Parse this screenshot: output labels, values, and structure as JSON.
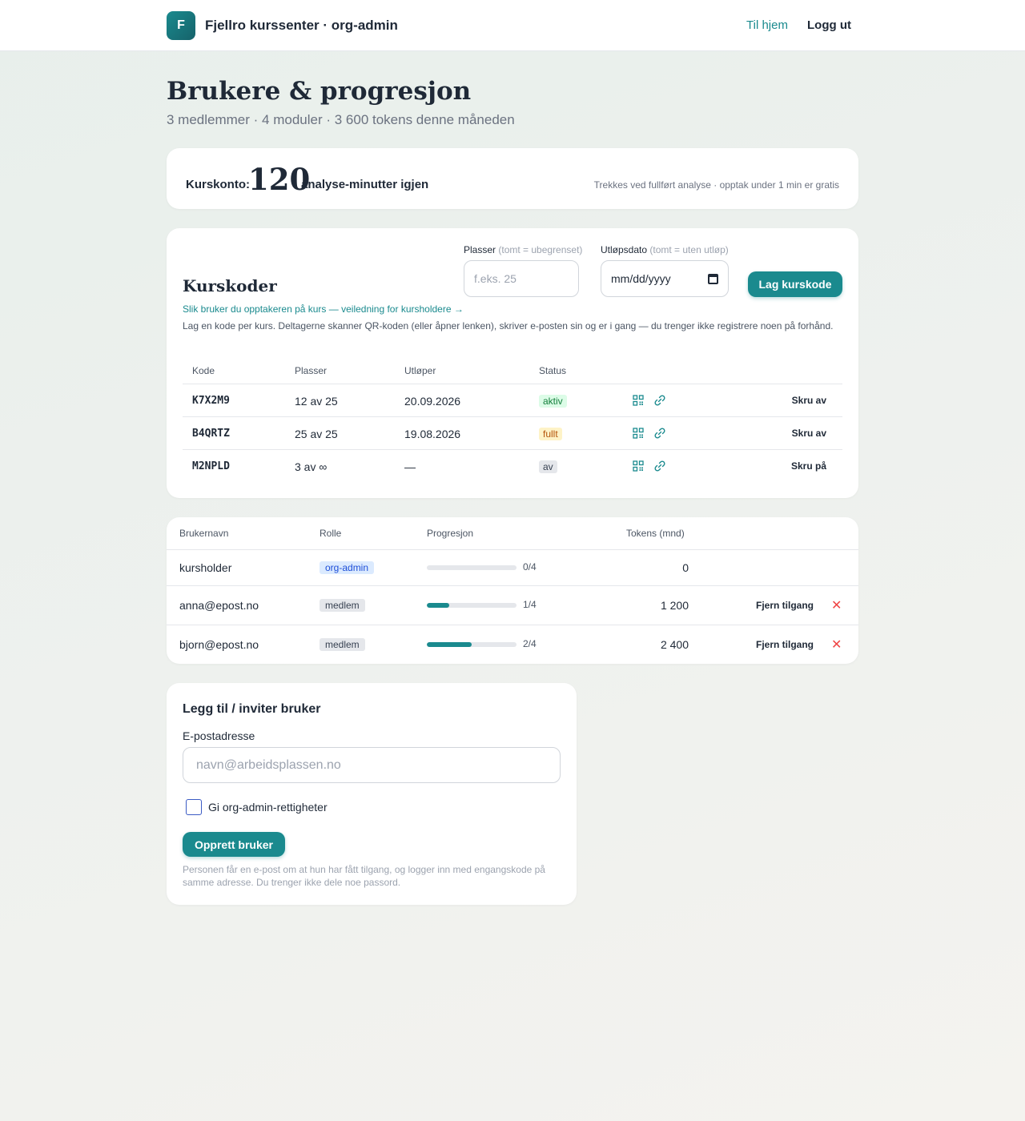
{
  "header": {
    "logo_letter": "F",
    "org_name": "Fjellro kurssenter · org-admin",
    "nav_home": "Til hjem",
    "nav_logout": "Logg ut"
  },
  "page": {
    "title": "Brukere & progresjon",
    "subtitle": "3 medlemmer · 4 moduler · 3 600 tokens denne måneden"
  },
  "account": {
    "label": "Kurskonto:",
    "minutes": "120",
    "suffix": "analyse-minutter igjen",
    "note": "Trekkes ved fullført analyse · opptak under 1 min er gratis"
  },
  "course_codes": {
    "title": "Kurskoder",
    "places_label": "Plasser",
    "places_hint": "(tomt = ubegrenset)",
    "places_placeholder": "f.eks. 25",
    "expiry_label": "Utløpsdato",
    "expiry_hint": "(tomt = uten utløp)",
    "expiry_value": "mm/dd/yyyy",
    "create_button": "Lag kurskode",
    "guide_link": "Slik bruker du opptakeren på kurs — veiledning for kursholdere →",
    "description": "Lag en kode per kurs. Deltagerne skanner QR-koden (eller åpner lenken), skriver e-posten sin og er i gang — du trenger ikke registrere noen på forhånd.",
    "columns": [
      "Kode",
      "Plasser",
      "Utløper",
      "Status"
    ],
    "rows": [
      {
        "code": "K7X2M9",
        "places": "12 av 25",
        "expires": "20.09.2026",
        "status": "aktiv",
        "status_kind": "aktiv",
        "action": "Skru av"
      },
      {
        "code": "B4QRTZ",
        "places": "25 av 25",
        "expires": "19.08.2026",
        "status": "fullt",
        "status_kind": "fullt",
        "action": "Skru av"
      },
      {
        "code": "M2NPLD",
        "places": "3 av ∞",
        "expires": "—",
        "status": "av",
        "status_kind": "av",
        "action": "Skru på"
      }
    ]
  },
  "users": {
    "columns": [
      "Brukernavn",
      "Rolle",
      "Progresjon",
      "Tokens (mnd)"
    ],
    "rows": [
      {
        "username": "kursholder",
        "role": "org-admin",
        "role_kind": "admin",
        "progress": 0,
        "progress_label": "0/4",
        "tokens": "0",
        "remove": "",
        "remove_x": ""
      },
      {
        "username": "anna@epost.no",
        "role": "medlem",
        "role_kind": "member",
        "progress": 0.25,
        "progress_label": "1/4",
        "tokens": "1 200",
        "remove": "Fjern tilgang",
        "remove_x": "✕"
      },
      {
        "username": "bjorn@epost.no",
        "role": "medlem",
        "role_kind": "member",
        "progress": 0.5,
        "progress_label": "2/4",
        "tokens": "2 400",
        "remove": "Fjern tilgang",
        "remove_x": "✕"
      }
    ]
  },
  "invite": {
    "title": "Legg til / inviter bruker",
    "email_label": "E-postadresse",
    "email_placeholder": "navn@arbeidsplassen.no",
    "admin_checkbox_label": "Gi org-admin-rettigheter",
    "admin_checked": false,
    "create_button": "Opprett bruker",
    "note": "Personen får en e-post om at hun har fått tilgang, og logger inn med engangskode på samme adresse. Du trenger ikke dele noe passord."
  },
  "colors": {
    "accent": "#1a8a8e",
    "danger": "#ef4444",
    "status_active": "#15803d",
    "status_full": "#b45309"
  },
  "icons": [
    "qr-code-icon",
    "link-icon",
    "calendar-icon",
    "close-icon"
  ]
}
